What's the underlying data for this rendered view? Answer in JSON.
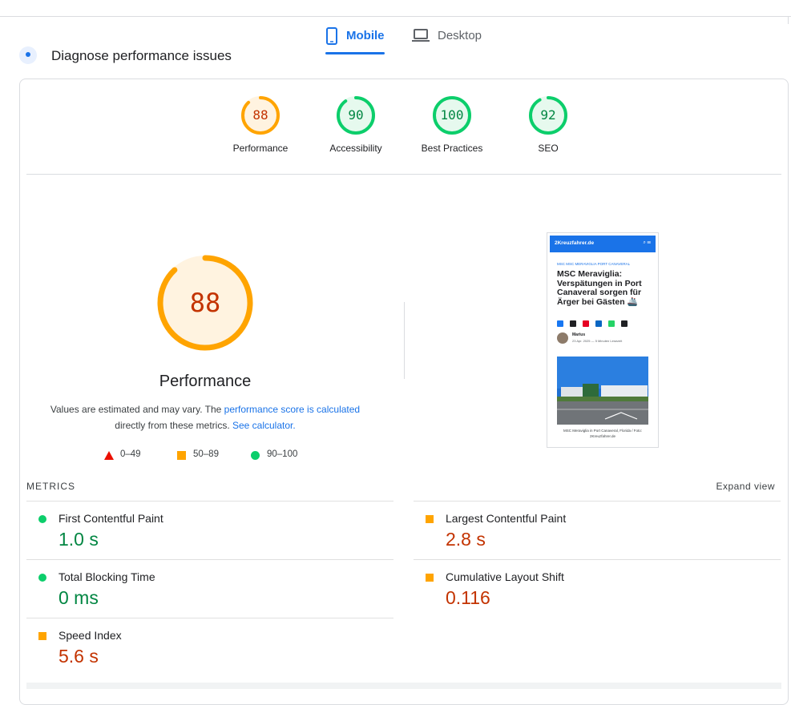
{
  "tabs": {
    "mobile": "Mobile",
    "desktop": "Desktop",
    "active_color": "#1a73e8"
  },
  "section": {
    "title": "Diagnose performance issues"
  },
  "categories": [
    {
      "label": "Performance",
      "score": "88",
      "status": "average"
    },
    {
      "label": "Accessibility",
      "score": "90",
      "status": "pass"
    },
    {
      "label": "Best Practices",
      "score": "100",
      "status": "pass"
    },
    {
      "label": "SEO",
      "score": "92",
      "status": "pass"
    }
  ],
  "main_gauge": {
    "score": "88",
    "title": "Performance"
  },
  "note": {
    "prefix": "Values are estimated and may vary. The ",
    "link1": "performance score is calculated",
    "middle": " directly from these metrics. ",
    "link2": "See calculator."
  },
  "legend": [
    {
      "range": "0–49",
      "shape": "triangle",
      "color": "#eb0f00"
    },
    {
      "range": "50–89",
      "shape": "square",
      "color": "#ffa400"
    },
    {
      "range": "90–100",
      "shape": "circle",
      "color": "#0cce6b"
    }
  ],
  "screenshot": {
    "site": "2Kreuzfahrer.de",
    "category": "MSC  MSC MERAVIGLIA  PORT CANAVERAL",
    "headline": "MSC Meraviglia: Verspätungen in Port Canaveral sorgen für Ärger bei Gästen 🚢",
    "author": "Marius",
    "meta": "23 Apr. 2025  —  5 Minuten Lesezeit",
    "caption": "MSC Meraviglia in Port Canaveral, Florida / Foto: 2Kreuzfahrer.de"
  },
  "metrics": {
    "title": "METRICS",
    "expand": "Expand view",
    "items": [
      {
        "name": "First Contentful Paint",
        "value": "1.0 s",
        "status": "pass"
      },
      {
        "name": "Largest Contentful Paint",
        "value": "2.8 s",
        "status": "average"
      },
      {
        "name": "Total Blocking Time",
        "value": "0 ms",
        "status": "pass"
      },
      {
        "name": "Cumulative Layout Shift",
        "value": "0.116",
        "status": "average"
      },
      {
        "name": "Speed Index",
        "value": "5.6 s",
        "status": "average"
      }
    ]
  },
  "colors": {
    "pass": "#0cce6b",
    "average": "#ffa400",
    "fail": "#eb0f00",
    "pass_text": "#018642",
    "average_text": "#c33300"
  }
}
